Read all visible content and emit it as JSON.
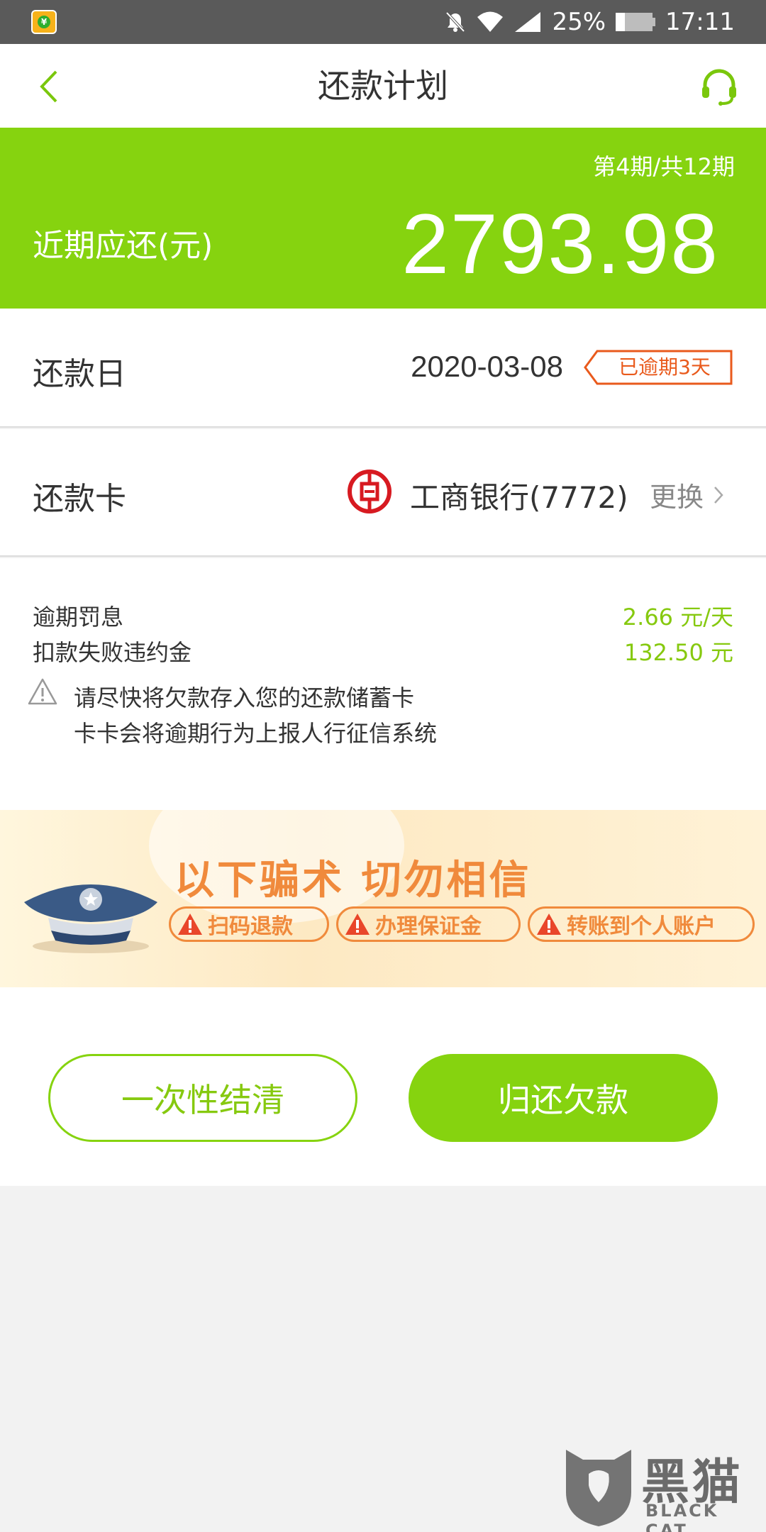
{
  "status_bar": {
    "battery": "25%",
    "battery_level": 0.25,
    "time": "17:11"
  },
  "header": {
    "title": "还款计划",
    "back_icon": "chevron-left-icon",
    "service_icon": "headset-icon"
  },
  "summary": {
    "period": "第4期/共12期",
    "due_label": "近期应还(元)",
    "due_amount": "2793.98"
  },
  "repayment_date": {
    "label": "还款日",
    "value": "2020-03-08",
    "badge": "已逾期3天"
  },
  "repayment_card": {
    "label": "还款卡",
    "bank": "工商银行(7772)",
    "change_label": "更换"
  },
  "penalties": {
    "items": [
      {
        "label": "逾期罚息",
        "value": "2.66 元/天"
      },
      {
        "label": "扣款失败违约金",
        "value": "132.50 元"
      }
    ],
    "warning_lines": [
      "请尽快将欠款存入您的还款储蓄卡",
      "卡卡会将逾期行为上报人行征信系统"
    ]
  },
  "fraud_banner": {
    "title": "以下骗术 切勿相信",
    "chips": [
      "扫码退款",
      "办理保证金",
      "转账到个人账户"
    ]
  },
  "actions": {
    "settle_label": "一次性结清",
    "repay_label": "归还欠款"
  },
  "watermark": {
    "cn": "黑猫",
    "en": "BLACK CAT"
  },
  "colors": {
    "brand_green": "#86d30f",
    "overdue_orange": "#e95a1c",
    "fraud_orange": "#f08a3c"
  }
}
